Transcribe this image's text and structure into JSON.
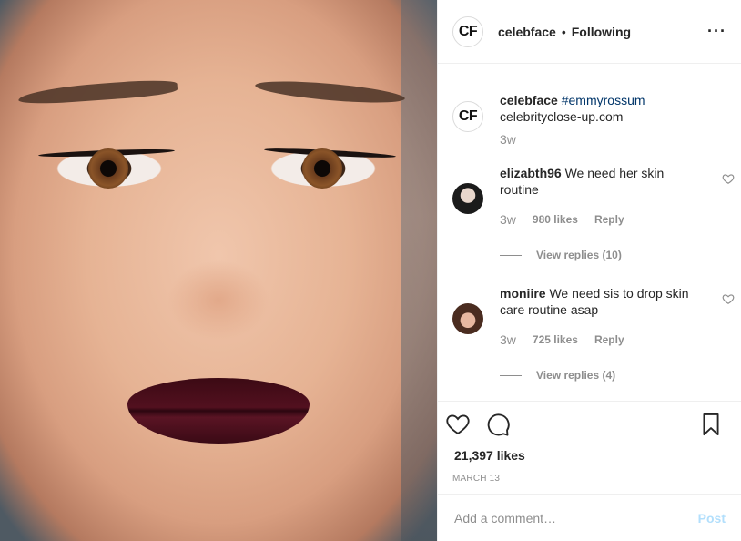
{
  "header": {
    "avatar_text": "CF",
    "username": "celebface",
    "separator": "•",
    "follow_status": "Following",
    "more": "···"
  },
  "caption": {
    "avatar_text": "CF",
    "username": "celebface",
    "hashtag": "#emmyrossum",
    "text": "celebrityclose-up.com",
    "age": "3w"
  },
  "comments": [
    {
      "username": "elizabth96",
      "text": "We need her skin routine",
      "age": "3w",
      "likes": "980 likes",
      "reply": "Reply",
      "view_replies": "View replies (10)"
    },
    {
      "username": "moniire",
      "text": "We need sis to drop skin care routine asap",
      "age": "3w",
      "likes": "725 likes",
      "reply": "Reply",
      "view_replies": "View replies (4)"
    }
  ],
  "likes_count": "21,397 likes",
  "date": "MARCH 13",
  "add_comment": {
    "placeholder": "Add a comment…",
    "post_label": "Post"
  },
  "colors": {
    "link": "#003569",
    "muted": "#8e8e8e",
    "post_disabled": "#b2dffc"
  }
}
